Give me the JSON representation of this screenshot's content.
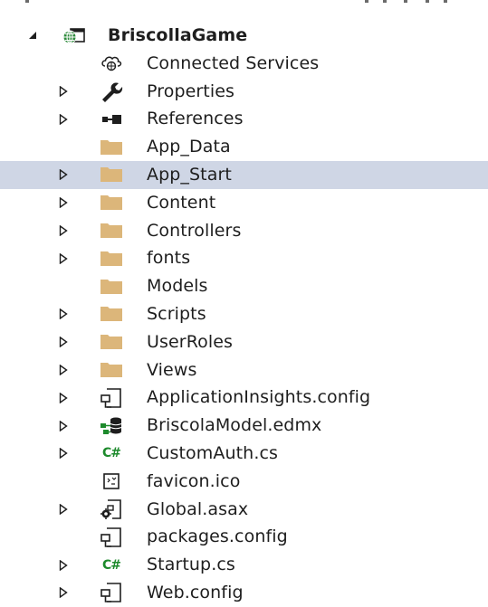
{
  "project": {
    "name": "BriscollaGame"
  },
  "items": [
    {
      "label": "Connected Services",
      "icon": "connected-services-icon",
      "expandable": false
    },
    {
      "label": "Properties",
      "icon": "wrench-icon",
      "expandable": true
    },
    {
      "label": "References",
      "icon": "references-icon",
      "expandable": true
    },
    {
      "label": "App_Data",
      "icon": "folder-icon",
      "expandable": false
    },
    {
      "label": "App_Start",
      "icon": "folder-icon",
      "expandable": true,
      "selected": true
    },
    {
      "label": "Content",
      "icon": "folder-icon",
      "expandable": true
    },
    {
      "label": "Controllers",
      "icon": "folder-icon",
      "expandable": true
    },
    {
      "label": "fonts",
      "icon": "folder-icon",
      "expandable": true
    },
    {
      "label": "Models",
      "icon": "folder-icon",
      "expandable": false
    },
    {
      "label": "Scripts",
      "icon": "folder-icon",
      "expandable": true
    },
    {
      "label": "UserRoles",
      "icon": "folder-icon",
      "expandable": true
    },
    {
      "label": "Views",
      "icon": "folder-icon",
      "expandable": true
    },
    {
      "label": "ApplicationInsights.config",
      "icon": "config-file-icon",
      "expandable": true
    },
    {
      "label": "BriscolaModel.edmx",
      "icon": "edmx-model-icon",
      "expandable": true
    },
    {
      "label": "CustomAuth.cs",
      "icon": "csharp-file-icon",
      "expandable": true
    },
    {
      "label": "favicon.ico",
      "icon": "ico-file-icon",
      "expandable": false
    },
    {
      "label": "Global.asax",
      "icon": "asax-file-icon",
      "expandable": true
    },
    {
      "label": "packages.config",
      "icon": "config-file-icon",
      "expandable": false
    },
    {
      "label": "Startup.cs",
      "icon": "csharp-file-icon",
      "expandable": true
    },
    {
      "label": "Web.config",
      "icon": "config-file-icon",
      "expandable": true
    }
  ],
  "colors": {
    "selection": "#cfd6e5",
    "folder": "#dcb67a",
    "csharp": "#1d8a2c",
    "globe": "#2e8b3c"
  }
}
